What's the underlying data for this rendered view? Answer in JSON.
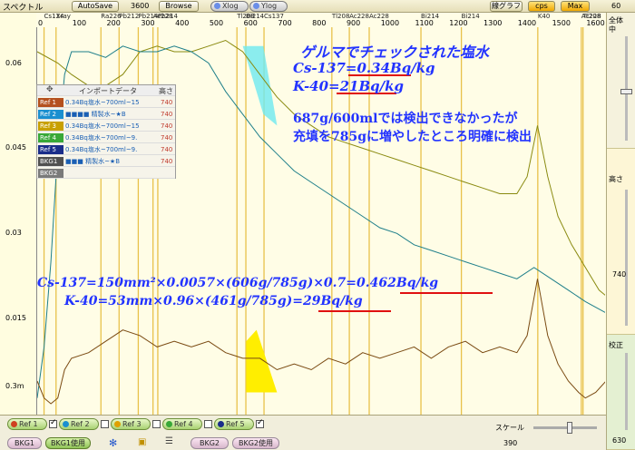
{
  "topbar": {
    "title": "スペクトル",
    "autosave_label": "AutoSave",
    "time_value": "3600",
    "browse_label": "Browse",
    "xlog_label": "Xlog",
    "ylog_label": "Ylog",
    "linegraph_label": "線グラフ",
    "cps_label": "cps",
    "max_label": "Max",
    "right_value": "60"
  },
  "xaxis": {
    "nuclides": [
      {
        "label": "Cs134",
        "e": 20
      },
      {
        "label": "Xray",
        "e": 55
      },
      {
        "label": "Ra226",
        "e": 186
      },
      {
        "label": "Pb212",
        "e": 239
      },
      {
        "label": "Pb214",
        "e": 295
      },
      {
        "label": "Ac228",
        "e": 338
      },
      {
        "label": "Pb214",
        "e": 352
      },
      {
        "label": "Tl208",
        "e": 583
      },
      {
        "label": "Bi214",
        "e": 609
      },
      {
        "label": "Cs137",
        "e": 662
      },
      {
        "label": "Ac228",
        "e": 911
      },
      {
        "label": "Tl208",
        "e": 860
      },
      {
        "label": "Ac228",
        "e": 969
      },
      {
        "label": "Bi214",
        "e": 1120
      },
      {
        "label": "Bi214",
        "e": 1238
      },
      {
        "label": "K40",
        "e": 1461
      },
      {
        "label": "Ac228",
        "e": 1588
      },
      {
        "label": "Tl208",
        "e": 1593
      }
    ],
    "ticks": [
      0,
      100,
      200,
      300,
      400,
      500,
      600,
      700,
      800,
      900,
      1000,
      1100,
      1200,
      1300,
      1400,
      1500,
      1600
    ]
  },
  "chart_data": {
    "type": "line",
    "title": "",
    "xlabel": "",
    "ylabel": "",
    "xlim": [
      0,
      1660
    ],
    "y_ticks": [
      "0.06",
      "0.045",
      "0.03",
      "0.015",
      "0.3m"
    ],
    "series": [
      {
        "name": "",
        "color": "#8a8a10",
        "points": [
          [
            0,
            0.062
          ],
          [
            60,
            0.06
          ],
          [
            100,
            0.058
          ],
          [
            150,
            0.056
          ],
          [
            200,
            0.056
          ],
          [
            250,
            0.058
          ],
          [
            300,
            0.062
          ],
          [
            350,
            0.063
          ],
          [
            400,
            0.062
          ],
          [
            450,
            0.062
          ],
          [
            500,
            0.063
          ],
          [
            550,
            0.064
          ],
          [
            600,
            0.062
          ],
          [
            650,
            0.058
          ],
          [
            700,
            0.054
          ],
          [
            750,
            0.051
          ],
          [
            800,
            0.049
          ],
          [
            850,
            0.047
          ],
          [
            900,
            0.046
          ],
          [
            950,
            0.045
          ],
          [
            1000,
            0.044
          ],
          [
            1050,
            0.043
          ],
          [
            1100,
            0.042
          ],
          [
            1150,
            0.041
          ],
          [
            1200,
            0.04
          ],
          [
            1250,
            0.039
          ],
          [
            1300,
            0.038
          ],
          [
            1350,
            0.037
          ],
          [
            1400,
            0.037
          ],
          [
            1430,
            0.04
          ],
          [
            1460,
            0.049
          ],
          [
            1490,
            0.04
          ],
          [
            1520,
            0.033
          ],
          [
            1560,
            0.028
          ],
          [
            1600,
            0.024
          ],
          [
            1640,
            0.02
          ],
          [
            1660,
            0.019
          ]
        ]
      },
      {
        "name": "",
        "color": "#1e7f8a",
        "points": [
          [
            0,
            0.001
          ],
          [
            20,
            0.01
          ],
          [
            40,
            0.025
          ],
          [
            60,
            0.045
          ],
          [
            80,
            0.058
          ],
          [
            100,
            0.062
          ],
          [
            150,
            0.062
          ],
          [
            200,
            0.061
          ],
          [
            250,
            0.063
          ],
          [
            300,
            0.062
          ],
          [
            350,
            0.062
          ],
          [
            400,
            0.063
          ],
          [
            450,
            0.062
          ],
          [
            500,
            0.06
          ],
          [
            550,
            0.055
          ],
          [
            600,
            0.051
          ],
          [
            650,
            0.047
          ],
          [
            700,
            0.044
          ],
          [
            750,
            0.041
          ],
          [
            800,
            0.039
          ],
          [
            850,
            0.037
          ],
          [
            900,
            0.035
          ],
          [
            950,
            0.033
          ],
          [
            1000,
            0.031
          ],
          [
            1050,
            0.03
          ],
          [
            1100,
            0.028
          ],
          [
            1150,
            0.027
          ],
          [
            1200,
            0.026
          ],
          [
            1250,
            0.025
          ],
          [
            1300,
            0.024
          ],
          [
            1350,
            0.023
          ],
          [
            1400,
            0.022
          ],
          [
            1450,
            0.024
          ],
          [
            1500,
            0.022
          ],
          [
            1550,
            0.02
          ],
          [
            1600,
            0.018
          ],
          [
            1660,
            0.016
          ]
        ]
      },
      {
        "name": "",
        "color": "#7a4a12",
        "points": [
          [
            0,
            0.004
          ],
          [
            20,
            0.001
          ],
          [
            40,
            0.0
          ],
          [
            60,
            0.001
          ],
          [
            80,
            0.006
          ],
          [
            100,
            0.008
          ],
          [
            150,
            0.009
          ],
          [
            200,
            0.011
          ],
          [
            250,
            0.013
          ],
          [
            300,
            0.012
          ],
          [
            350,
            0.01
          ],
          [
            400,
            0.011
          ],
          [
            450,
            0.01
          ],
          [
            500,
            0.011
          ],
          [
            550,
            0.009
          ],
          [
            600,
            0.008
          ],
          [
            650,
            0.008
          ],
          [
            700,
            0.006
          ],
          [
            750,
            0.007
          ],
          [
            800,
            0.006
          ],
          [
            850,
            0.008
          ],
          [
            900,
            0.007
          ],
          [
            950,
            0.009
          ],
          [
            1000,
            0.008
          ],
          [
            1050,
            0.009
          ],
          [
            1100,
            0.01
          ],
          [
            1150,
            0.008
          ],
          [
            1200,
            0.01
          ],
          [
            1250,
            0.011
          ],
          [
            1300,
            0.009
          ],
          [
            1350,
            0.01
          ],
          [
            1400,
            0.009
          ],
          [
            1430,
            0.012
          ],
          [
            1460,
            0.022
          ],
          [
            1490,
            0.012
          ],
          [
            1520,
            0.007
          ],
          [
            1550,
            0.004
          ],
          [
            1580,
            0.002
          ],
          [
            1600,
            0.001
          ],
          [
            1630,
            0.002
          ],
          [
            1660,
            0.004
          ]
        ]
      }
    ]
  },
  "legend": {
    "header_name": "インポートデータ",
    "header_height": "高さ",
    "rows": [
      {
        "tag": "Ref 1",
        "name": "0.34Bq塩水~700ml~15",
        "height": "740",
        "color": "#b4501e"
      },
      {
        "tag": "Ref 2",
        "name": "■■■■ 精製水~★B",
        "height": "740",
        "color": "#1a8fd0"
      },
      {
        "tag": "Ref 3",
        "name": "0.34Bq塩水~700ml~15",
        "height": "740",
        "color": "#c8a000"
      },
      {
        "tag": "Ref 4",
        "name": "0.34Bq塩水~700ml~9.",
        "height": "740",
        "color": "#38a838"
      },
      {
        "tag": "Ref 5",
        "name": "0.34Bq塩水~700ml~9.",
        "height": "740",
        "color": "#1a2d8a"
      },
      {
        "tag": "BKG1",
        "name": "■■■ 精製水~★B",
        "height": "740",
        "color": "#505050"
      },
      {
        "tag": "BKG2",
        "name": "",
        "height": "",
        "color": "#7a7a7a"
      }
    ]
  },
  "annotations": {
    "line1": "ゲルマでチェックされた塩水",
    "line2": "Cs-137=0.34Bq/kg",
    "line3": "K-40=21Bq/kg",
    "line4": "687g/600mlでは検出できなかったが",
    "line5": "充填を785gに増やしたところ明確に検出",
    "line6": "Cs-137=150mm²×0.0057×(606g/785g)×0.7=0.462Bq/kg",
    "line7": "K-40=53mm×0.96×(461g/785g)=29Bq/kg"
  },
  "rightpanel": {
    "all_label": "全体",
    "middle_label": "中",
    "height_label": "高さ",
    "height_value": "740",
    "calib_label": "校正",
    "bottom_value": "630"
  },
  "bottombar": {
    "refs": [
      {
        "label": "Ref 1",
        "color": "#d04020",
        "checked": true
      },
      {
        "label": "Ref 2",
        "color": "#1a8fd0",
        "checked": false
      },
      {
        "label": "Ref 3",
        "color": "#e0a000",
        "checked": false
      },
      {
        "label": "Ref 4",
        "color": "#38a838",
        "checked": false
      },
      {
        "label": "Ref 5",
        "color": "#1a2d8a",
        "checked": true
      }
    ],
    "bkg1_label": "BKG1",
    "bkg1_use_label": "BKG1使用",
    "bkg2_label": "BKG2",
    "bkg2_use_label": "BKG2使用",
    "scale_label": "スケール",
    "scale_value": "390"
  }
}
